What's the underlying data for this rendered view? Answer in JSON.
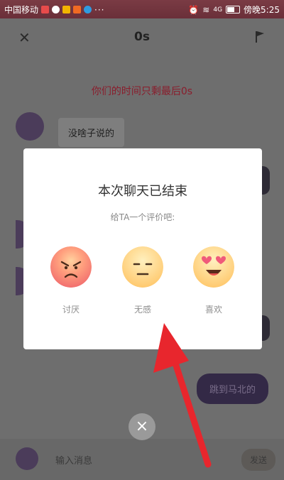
{
  "status_bar": {
    "carrier": "中国移动",
    "dots": "···",
    "signal": "4G",
    "time": "傍晚5:25"
  },
  "app": {
    "title": "0s",
    "timer_notice": "你们的时间只剩最后0s",
    "incoming_message": "没啥子说的",
    "outgoing_message": "跳到马北的",
    "input_placeholder": "输入消息",
    "send_label": "发送"
  },
  "dialog": {
    "title": "本次聊天已结束",
    "subtitle": "给TA一个评价吧:",
    "options": [
      {
        "label": "讨厌",
        "icon": "angry-face-icon"
      },
      {
        "label": "无感",
        "icon": "neutral-face-icon"
      },
      {
        "label": "喜欢",
        "icon": "heart-eyes-face-icon"
      }
    ]
  },
  "close_button": {
    "glyph": "×"
  },
  "colors": {
    "annotation_arrow": "#e8262d",
    "timer_text": "#8a1d2c",
    "dialog_bg": "#ffffff"
  }
}
